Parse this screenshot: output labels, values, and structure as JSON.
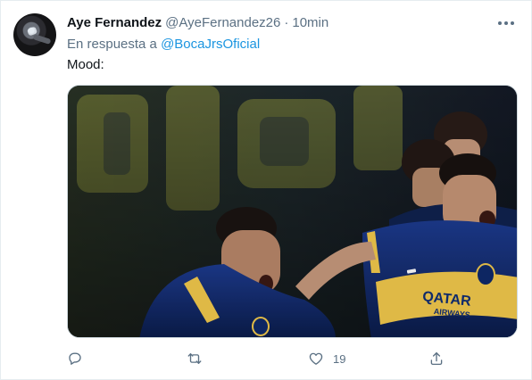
{
  "tweet": {
    "author_name": "Aye Fernandez",
    "author_handle": "@AyeFernandez26",
    "separator": "·",
    "time": "10min",
    "reply_prefix": "En respuesta a",
    "reply_handle": "@BocaJrsOficial",
    "text": "Mood:",
    "likes": "19",
    "media_kit_text": "QATAR",
    "media_kit_subtext": "AIRWAYS"
  },
  "icons": {
    "more": "more-dots-icon",
    "reply": "reply-icon",
    "retweet": "retweet-icon",
    "like": "heart-icon",
    "share": "share-icon"
  },
  "colors": {
    "link": "#1b95e0",
    "secondary_text": "#5b7083",
    "kit_navy": "#0f2a6b",
    "kit_gold": "#f2c94c"
  }
}
